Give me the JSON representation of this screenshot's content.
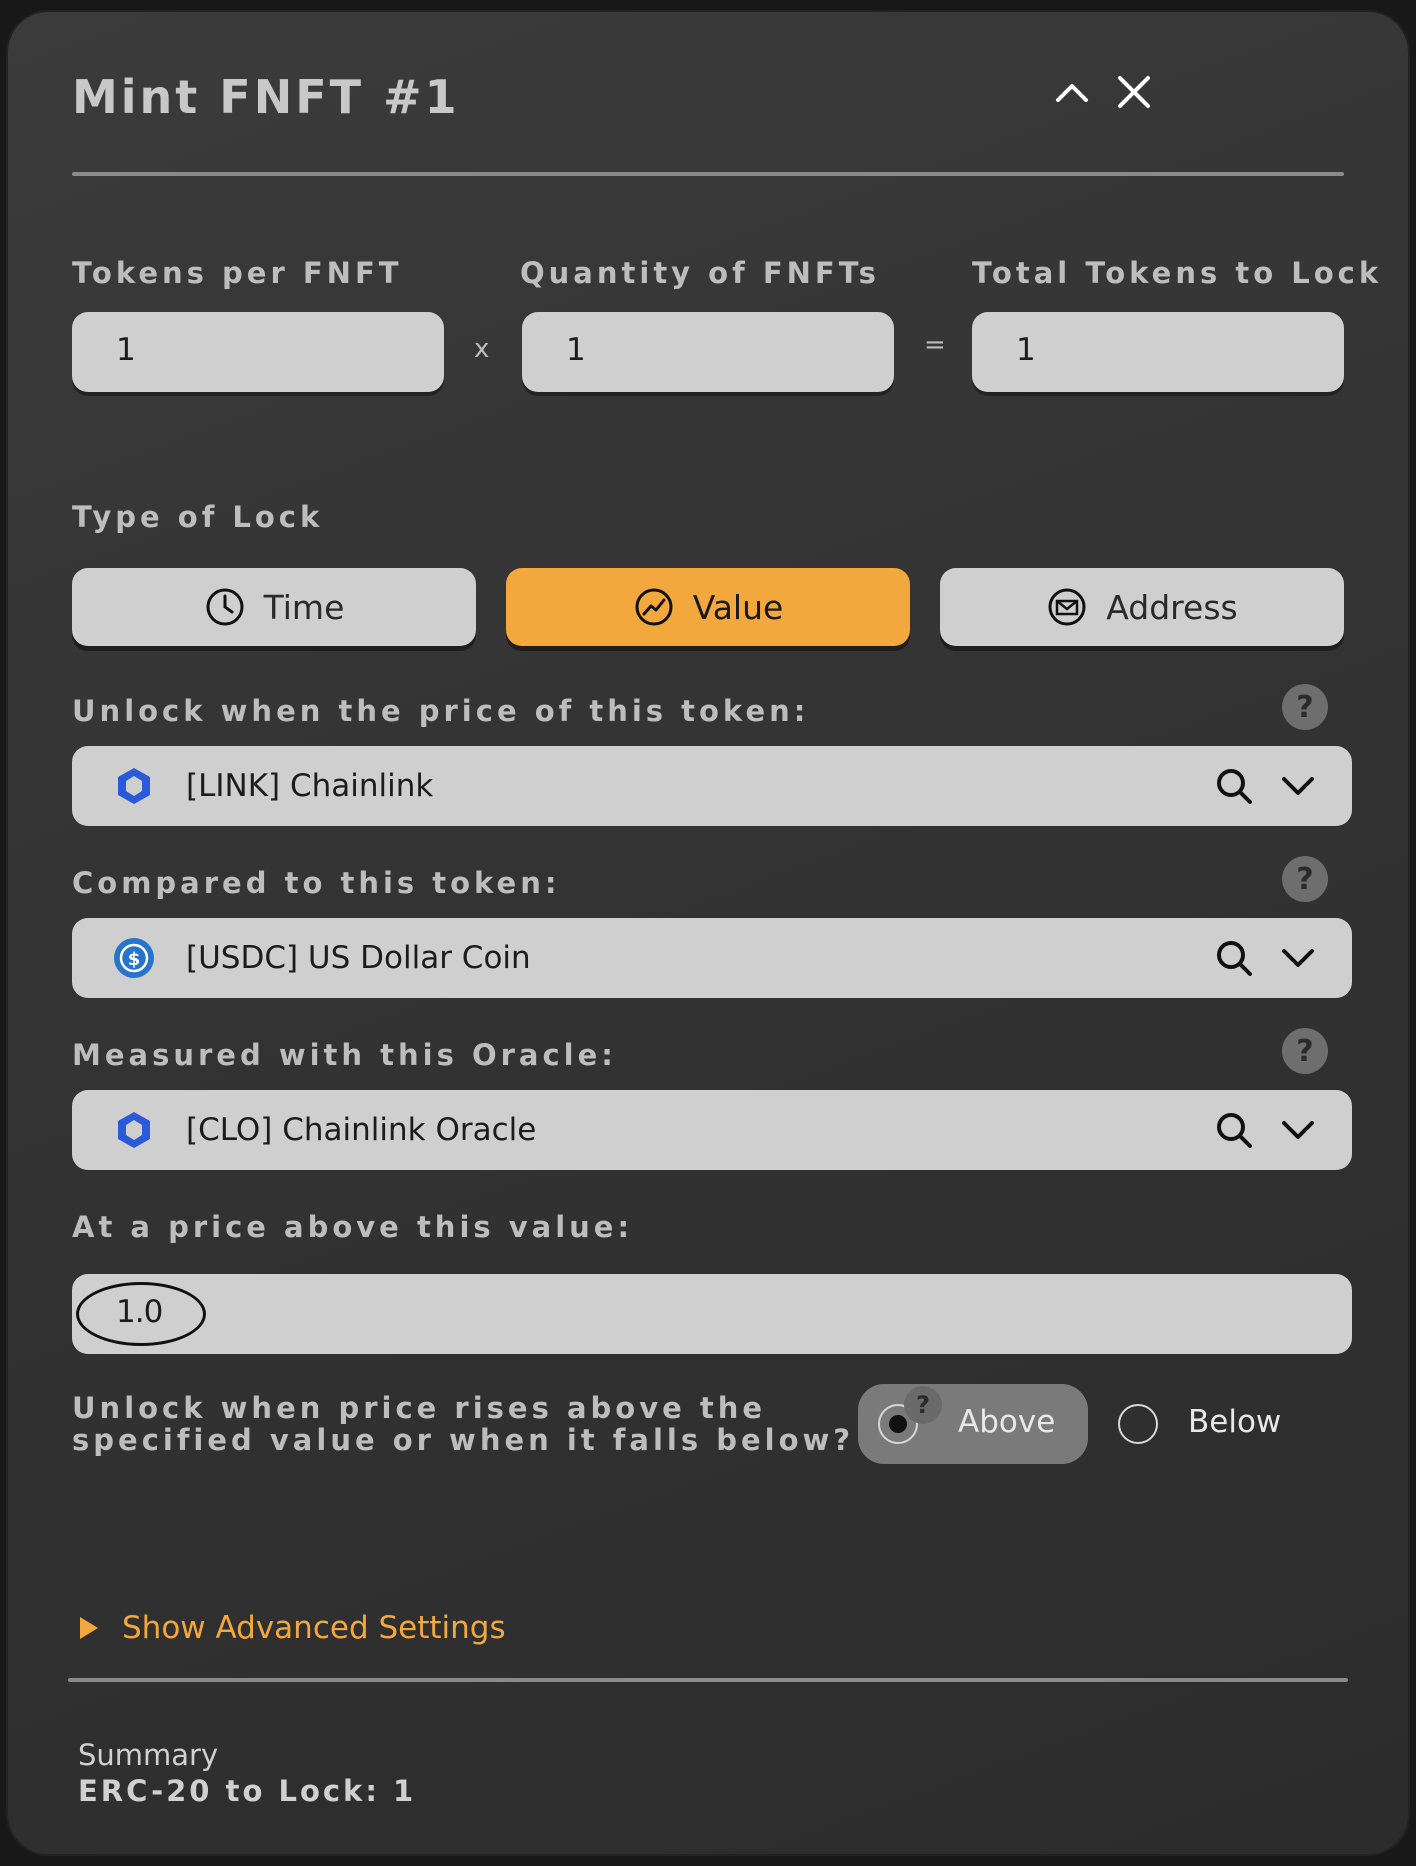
{
  "modal": {
    "title": "Mint FNFT #1"
  },
  "amounts": {
    "tokens_per_fnft_label": "Tokens per FNFT",
    "tokens_per_fnft_value": "1",
    "multiply_symbol": "x",
    "quantity_label": "Quantity of FNFTs",
    "quantity_value": "1",
    "equals_symbol": "=",
    "total_label": "Total Tokens to Lock",
    "total_value": "1"
  },
  "lock_type": {
    "label": "Type of Lock",
    "options": [
      {
        "label": "Time",
        "icon": "clock-icon",
        "selected": false
      },
      {
        "label": "Value",
        "icon": "chart-trend-icon",
        "selected": true
      },
      {
        "label": "Address",
        "icon": "mail-icon",
        "selected": false
      }
    ]
  },
  "token_select": {
    "label": "Unlock when the price of this token:",
    "value": "[LINK] Chainlink",
    "icon": "chainlink-icon"
  },
  "compare_select": {
    "label": "Compared to this token:",
    "value": "[USDC] US Dollar Coin",
    "icon": "usdc-icon"
  },
  "oracle_select": {
    "label": "Measured with this Oracle:",
    "value": "[CLO] Chainlink Oracle",
    "icon": "chainlink-icon"
  },
  "price": {
    "label": "At a price above this value:",
    "value": "1.0"
  },
  "direction": {
    "question_line1": "Unlock when price rises above the",
    "question_line2": "specified value or when it falls below?",
    "above_label": "Above",
    "below_label": "Below",
    "selected": "Above",
    "help_text": "?"
  },
  "advanced": {
    "label": "Show Advanced Settings"
  },
  "summary": {
    "heading": "Summary",
    "line": "ERC-20 to Lock: 1"
  },
  "colors": {
    "accent": "#f2a83c",
    "field_bg": "#cfcfcf",
    "panel_bg": "#333333"
  }
}
